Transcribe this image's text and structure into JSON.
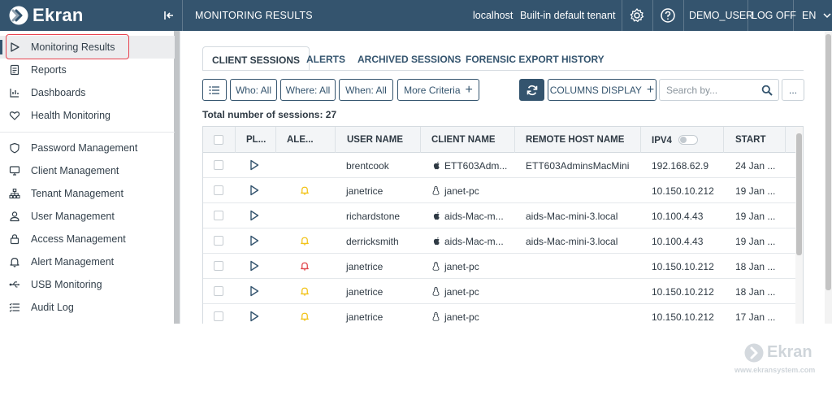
{
  "brand": {
    "name": "Ekran",
    "watermark": "Ekran",
    "watermark_url": "www.ekransystem.com"
  },
  "header": {
    "title": "MONITORING RESULTS",
    "host": "localhost",
    "tenant": "Built-in default tenant",
    "user": "DEMO_USER",
    "logoff": "LOG OFF",
    "language": "EN"
  },
  "sidebar": {
    "items": [
      {
        "label": "Monitoring Results",
        "icon": "play-icon"
      },
      {
        "label": "Reports",
        "icon": "report-icon"
      },
      {
        "label": "Dashboards",
        "icon": "chart-icon"
      },
      {
        "label": "Health Monitoring",
        "icon": "heart-icon"
      },
      {
        "label": "Password Management",
        "icon": "shield-icon"
      },
      {
        "label": "Client Management",
        "icon": "monitor-icon"
      },
      {
        "label": "Tenant Management",
        "icon": "hierarchy-icon"
      },
      {
        "label": "User Management",
        "icon": "user-icon"
      },
      {
        "label": "Access Management",
        "icon": "lock-icon"
      },
      {
        "label": "Alert Management",
        "icon": "bell-icon"
      },
      {
        "label": "USB Monitoring",
        "icon": "usb-icon"
      },
      {
        "label": "Audit Log",
        "icon": "list-icon"
      }
    ]
  },
  "tabs": [
    "CLIENT SESSIONS",
    "ALERTS",
    "ARCHIVED SESSIONS",
    "FORENSIC EXPORT HISTORY"
  ],
  "toolbar": {
    "who": "Who: All",
    "where": "Where: All",
    "when": "When: All",
    "more": "More Criteria",
    "columns": "COLUMNS DISPLAY",
    "search_placeholder": "Search by...",
    "more_dots": "..."
  },
  "total": "Total number of sessions: 27",
  "table": {
    "columns": [
      "PL...",
      "ALE...",
      "USER NAME",
      "CLIENT NAME",
      "REMOTE HOST NAME",
      "IPV4",
      "START"
    ],
    "rows": [
      {
        "alert": "",
        "user": "brentcook",
        "os": "apple",
        "client": "ETT603Adm...",
        "remote": "ETT603AdminsMacMini",
        "ip": "192.168.62.9",
        "start": "24 Jan ..."
      },
      {
        "alert": "yellow",
        "user": "janetrice",
        "os": "linux",
        "client": "janet-pc",
        "remote": "",
        "ip": "10.150.10.212",
        "start": "19 Jan ..."
      },
      {
        "alert": "",
        "user": "richardstone",
        "os": "apple",
        "client": "aids-Mac-m...",
        "remote": "aids-Mac-mini-3.local",
        "ip": "10.100.4.43",
        "start": "19 Jan ..."
      },
      {
        "alert": "yellow",
        "user": "derricksmith",
        "os": "apple",
        "client": "aids-Mac-m...",
        "remote": "aids-Mac-mini-3.local",
        "ip": "10.100.4.43",
        "start": "19 Jan ..."
      },
      {
        "alert": "red",
        "user": "janetrice",
        "os": "linux",
        "client": "janet-pc",
        "remote": "",
        "ip": "10.150.10.212",
        "start": "18 Jan ..."
      },
      {
        "alert": "yellow",
        "user": "janetrice",
        "os": "linux",
        "client": "janet-pc",
        "remote": "",
        "ip": "10.150.10.212",
        "start": "18 Jan ..."
      },
      {
        "alert": "yellow",
        "user": "janetrice",
        "os": "linux",
        "client": "janet-pc",
        "remote": "",
        "ip": "10.150.10.212",
        "start": "17 Jan ..."
      }
    ]
  },
  "colors": {
    "header": "#34546e",
    "highlight": "#e8434f",
    "alert_yellow": "#f2c31a",
    "alert_red": "#e0474c"
  }
}
